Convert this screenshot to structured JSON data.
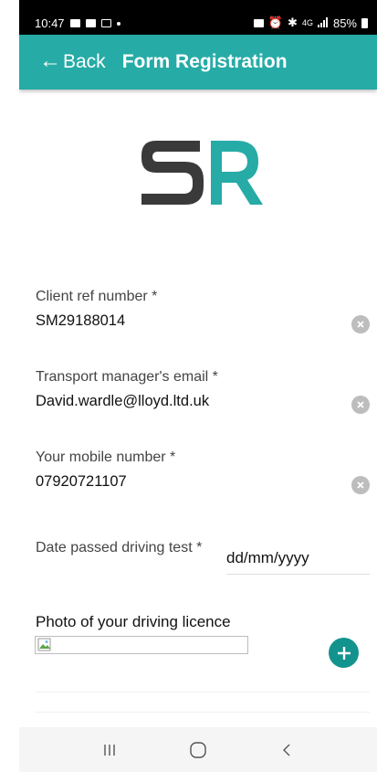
{
  "status_bar": {
    "time": "10:47",
    "network": "4G",
    "battery": "85%"
  },
  "app_bar": {
    "back_arrow": "←",
    "back_label": "Back",
    "title": "Form Registration"
  },
  "logo": {
    "letters": "SR",
    "colors": {
      "s": "#3a3a3a",
      "r": "#26aba6"
    }
  },
  "form": {
    "client_ref": {
      "label": "Client ref number *",
      "value": "SM29188014"
    },
    "email": {
      "label": "Transport manager's email *",
      "value": "David.wardle@lloyd.ltd.uk"
    },
    "mobile": {
      "label": "Your mobile number *",
      "value": "07920721107"
    },
    "date_passed": {
      "label": "Date passed driving test *",
      "placeholder": "dd/mm/yyyy"
    },
    "photo": {
      "label": "Photo of your driving licence"
    }
  },
  "icons": {
    "clear": "clear-icon",
    "add": "plus-icon",
    "nav_recents": "recents-icon",
    "nav_home": "home-icon",
    "nav_back": "back-icon"
  },
  "colors": {
    "accent": "#26aba6",
    "add_button": "#13938e",
    "status_bar": "#000000"
  }
}
